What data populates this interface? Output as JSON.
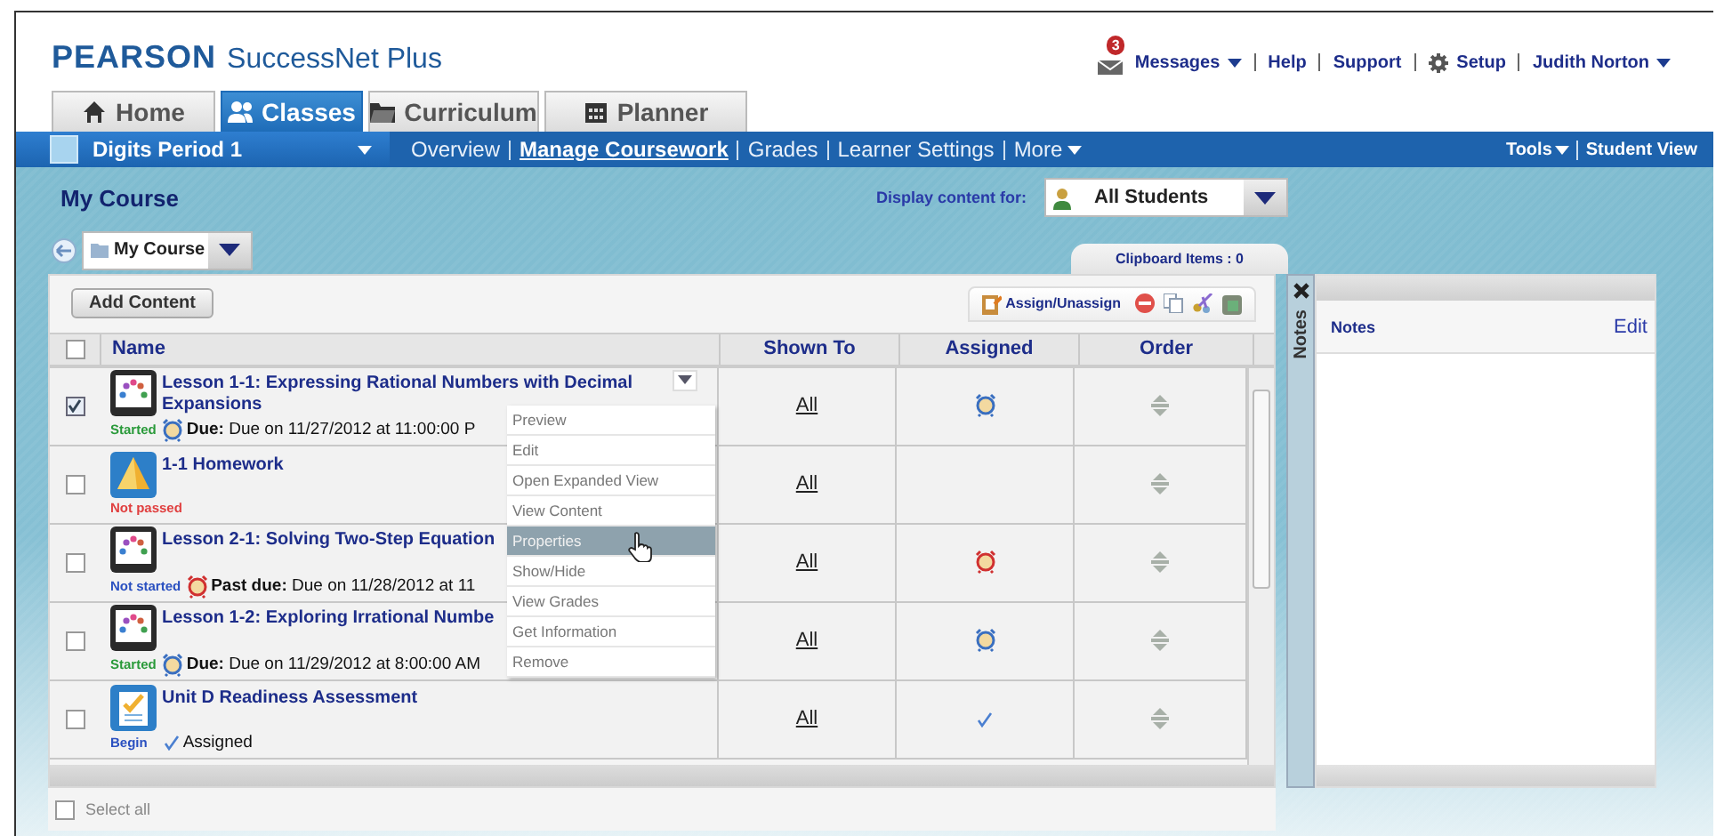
{
  "header": {
    "logo_brand": "PEARSON",
    "logo_product": "SuccessNet Plus",
    "messages_count": "3",
    "links": [
      {
        "label": "Messages",
        "kind": "messages"
      },
      {
        "label": "Help",
        "kind": "link"
      },
      {
        "label": "Support",
        "kind": "link"
      },
      {
        "label": "Setup",
        "kind": "setup"
      },
      {
        "label": "Judith Norton",
        "kind": "user"
      }
    ]
  },
  "tabs": [
    {
      "label": "Home",
      "kind": "home",
      "selected": false
    },
    {
      "label": "Classes",
      "kind": "classes",
      "selected": true
    },
    {
      "label": "Curriculum",
      "kind": "curriculum",
      "selected": false
    },
    {
      "label": "Planner",
      "kind": "planner",
      "selected": false
    }
  ],
  "class_bar": {
    "class_name": "Digits Period 1",
    "links": [
      {
        "label": "Overview",
        "selected": false
      },
      {
        "label": "Manage Coursework",
        "selected": true
      },
      {
        "label": "Grades",
        "selected": false
      },
      {
        "label": "Learner Settings",
        "selected": false
      },
      {
        "label": "More",
        "selected": false,
        "kind": "menu"
      }
    ],
    "tools": "Tools",
    "student_view": "Student View"
  },
  "course": {
    "title": "My Course",
    "display_label": "Display content for:",
    "display_value": "All Students",
    "folder": "My Course",
    "clipboard": "Clipboard Items : 0",
    "add_button": "Add Content",
    "assign_button": "Assign/Unassign"
  },
  "table": {
    "all_checked": false,
    "columns": [
      "Name",
      "Shown To",
      "Assigned",
      "Order"
    ],
    "rows": [
      {
        "checked": true,
        "kind": "lesson",
        "title": "Lesson 1-1: Expressing Rational Numbers with Decimal Expansions",
        "status": {
          "text": "Started",
          "kind": "started"
        },
        "due": {
          "kind": "due",
          "label": "Due:",
          "text": "Due on 11/27/2012 at 11:00:00 P"
        },
        "shown_to": "All",
        "assigned": {
          "kind": "due"
        },
        "menu_open": true
      },
      {
        "checked": false,
        "kind": "homework",
        "title": "1-1 Homework",
        "status": {
          "text": "Not passed",
          "kind": "failed"
        },
        "shown_to": "All"
      },
      {
        "checked": false,
        "kind": "lesson",
        "title": "Lesson 2-1: Solving Two-Step Equation",
        "status": {
          "text": "Not started",
          "kind": "new"
        },
        "due": {
          "kind": "past_due",
          "label": "Past due:",
          "text": "Due on 11/28/2012 at 11"
        },
        "shown_to": "All",
        "assigned": {
          "kind": "past_due"
        }
      },
      {
        "checked": false,
        "kind": "lesson",
        "title": "Lesson 1-2: Exploring Irrational Numbe",
        "status": {
          "text": "Started",
          "kind": "started"
        },
        "due": {
          "kind": "due",
          "label": "Due:",
          "text": "Due on 11/29/2012 at 8:00:00 AM"
        },
        "shown_to": "All",
        "assigned": {
          "kind": "due"
        }
      },
      {
        "checked": false,
        "kind": "assessment",
        "title": "Unit D Readiness Assessment",
        "status": {
          "text": "Begin",
          "kind": "new"
        },
        "due": {
          "kind": "assigned",
          "text": "Assigned"
        },
        "shown_to": "All",
        "assigned": {
          "kind": "check"
        }
      }
    ]
  },
  "context_menu": {
    "items": [
      {
        "label": "Preview",
        "selected": false
      },
      {
        "label": "Edit",
        "selected": false
      },
      {
        "label": "Open Expanded View",
        "selected": false
      },
      {
        "label": "View Content",
        "selected": false
      },
      {
        "label": "Properties",
        "selected": true
      },
      {
        "label": "Show/Hide",
        "selected": false
      },
      {
        "label": "View Grades",
        "selected": false
      },
      {
        "label": "Get Information",
        "selected": false
      },
      {
        "label": "Remove",
        "selected": false
      }
    ]
  },
  "select_all": {
    "label": "Select all",
    "checked": false
  },
  "notes": {
    "tab_label": "Notes",
    "title": "Notes",
    "edit": "Edit"
  }
}
